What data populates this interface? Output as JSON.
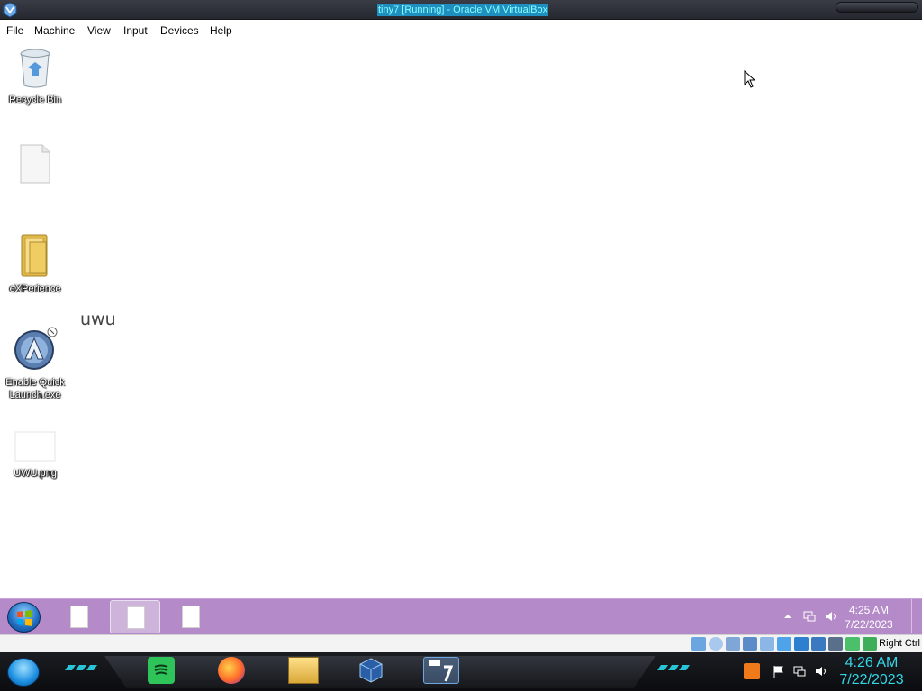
{
  "window": {
    "title": "tiny7 [Running] - Oracle VM VirtualBox"
  },
  "menu": {
    "items": [
      "File",
      "Machine",
      "View",
      "Input",
      "Devices",
      "Help"
    ]
  },
  "desktop": {
    "icons": [
      {
        "label": "Recycle Bin",
        "icon": "recycle-bin-icon"
      },
      {
        "label": "",
        "icon": "blank-file-icon"
      },
      {
        "label": "eXPerience",
        "icon": "folder-icon"
      },
      {
        "label": "Enable Quick Launch.exe",
        "icon": "aim-app-icon"
      },
      {
        "label": "UWU.png",
        "icon": "image-file-icon"
      }
    ],
    "text": "uwu"
  },
  "guest_taskbar": {
    "buttons": [
      {
        "icon": "document-icon",
        "active": false
      },
      {
        "icon": "document-icon",
        "active": true
      },
      {
        "icon": "document-icon",
        "active": false
      }
    ],
    "tray_icons": [
      "show-hidden-icons-arrow",
      "network-icon",
      "volume-icon"
    ],
    "clock": {
      "time": "4:25 AM",
      "date": "7/22/2023"
    }
  },
  "vbox_status": {
    "icons": [
      "hard-disk-icon",
      "optical-drive-icon",
      "audio-icon",
      "network-adapter-icon",
      "usb-icon",
      "shared-folders-icon",
      "display-icon",
      "recording-icon",
      "cpu-icon",
      "mouse-integration-icon",
      "keyboard-icon"
    ],
    "host_key": "Right Ctrl"
  },
  "host_taskbar": {
    "apps": [
      "spotify-icon",
      "firefox-icon",
      "file-explorer-icon",
      "virtualbox-icon",
      "tiny7-vm-icon"
    ],
    "tray_icons": [
      "action-center-icon",
      "flag-icon",
      "network-icon",
      "volume-icon"
    ],
    "clock": {
      "time": "4:26 AM",
      "date": "7/22/2023"
    }
  },
  "colors": {
    "guest_taskbar": "#b48ac8",
    "host_clock": "#33d6e6",
    "title_highlight": "#1f8fbf"
  }
}
